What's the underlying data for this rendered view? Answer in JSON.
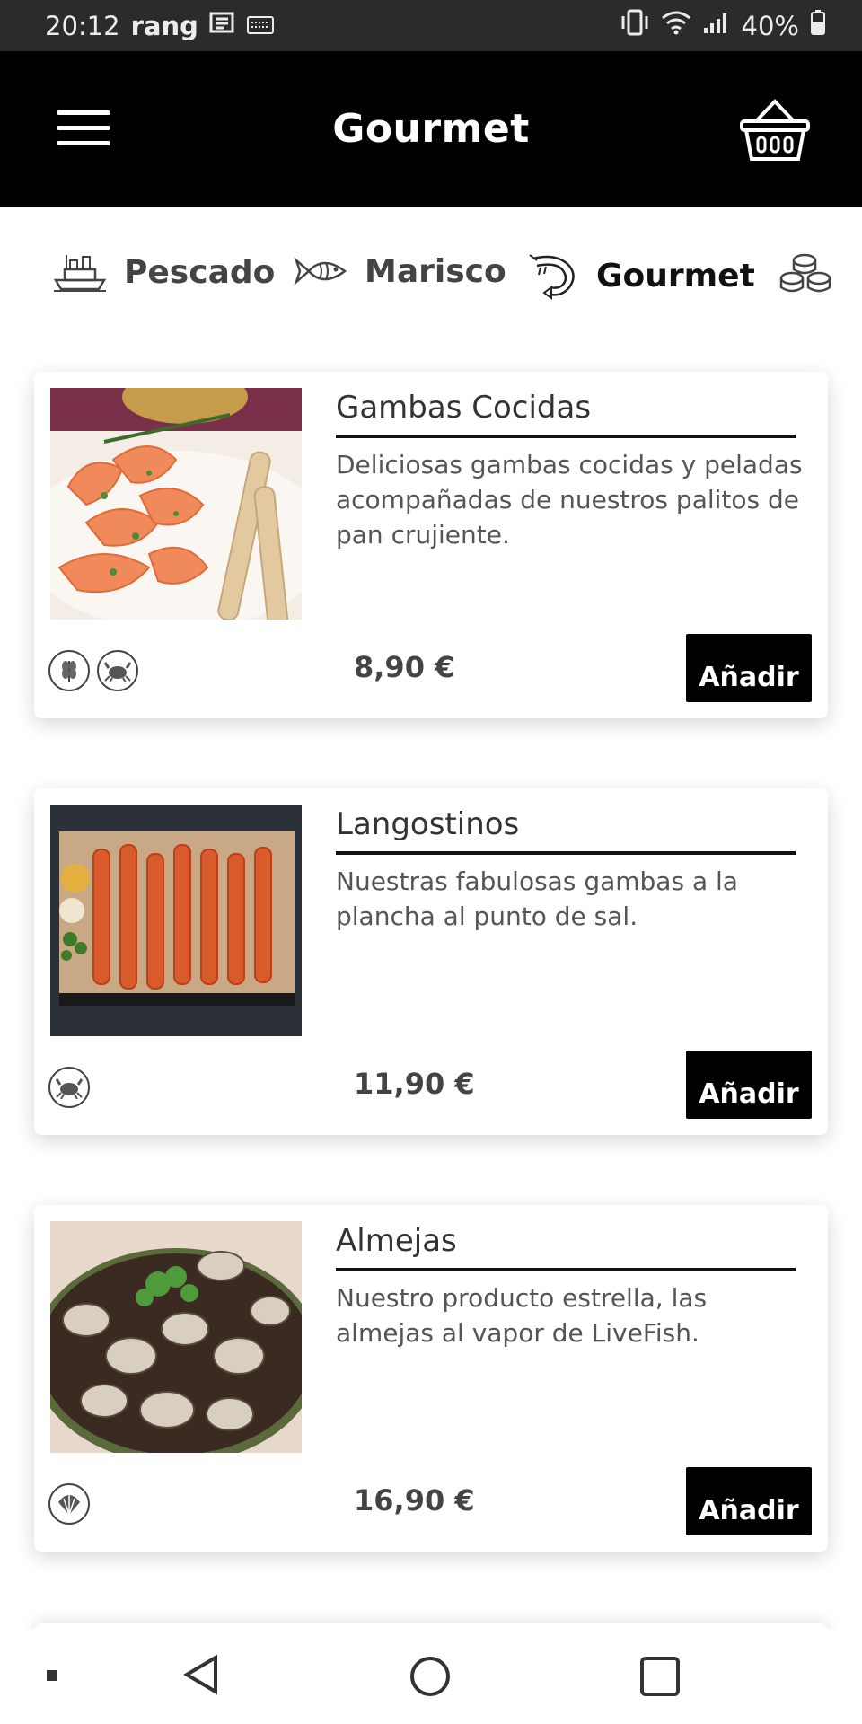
{
  "status_bar": {
    "time": "20:12",
    "carrier": "rang",
    "battery": "40%"
  },
  "app_bar": {
    "title": "Gourmet"
  },
  "categories": [
    {
      "label": "Pescado",
      "icon": "boat-icon",
      "active": false
    },
    {
      "label": "Marisco",
      "icon": "fish-icon",
      "active": false
    },
    {
      "label": "Gourmet",
      "icon": "shrimp-icon",
      "active": true
    },
    {
      "label": "",
      "icon": "sushi-icon",
      "active": false
    }
  ],
  "products": [
    {
      "name": "Gambas Cocidas",
      "description": "Deliciosas gambas cocidas y peladas acompañadas de nuestros palitos de pan crujiente.",
      "price": "8,90 €",
      "allergens": [
        "gluten-icon",
        "crustacean-icon"
      ],
      "button_label": "Añadir"
    },
    {
      "name": "Langostinos",
      "description": "Nuestras fabulosas gambas a la plancha al punto de sal.",
      "price": "11,90 €",
      "allergens": [
        "crustacean-icon"
      ],
      "button_label": "Añadir"
    },
    {
      "name": "Almejas",
      "description": "Nuestro producto estrella, las almejas al vapor de LiveFish.",
      "price": "16,90 €",
      "allergens": [
        "mollusc-icon"
      ],
      "button_label": "Añadir"
    }
  ],
  "colors": {
    "app_bar": "#000000",
    "button_bg": "#000000",
    "button_text": "#ffffff",
    "status_bar": "#2b2b2b"
  }
}
